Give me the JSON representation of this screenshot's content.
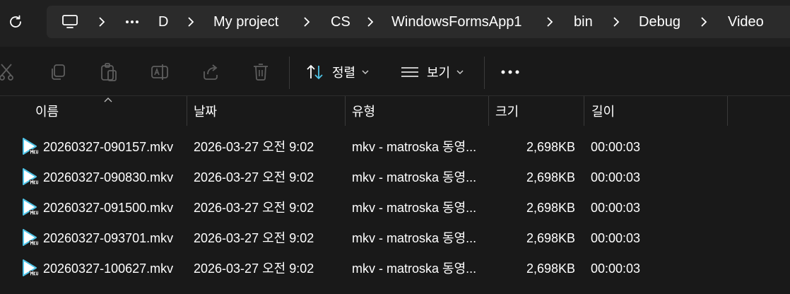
{
  "address": {
    "crumbs": [
      "D",
      "My project",
      "CS",
      "WindowsFormsApp1",
      "bin",
      "Debug",
      "Video"
    ]
  },
  "toolbar": {
    "sort_label": "정렬",
    "view_label": "보기"
  },
  "columns": [
    "이름",
    "날짜",
    "유형",
    "크기",
    "길이"
  ],
  "files": [
    {
      "name": "20260327-090157.mkv",
      "date": "2026-03-27 오전 9:02",
      "type": "mkv - matroska 동영...",
      "size": "2,698KB",
      "length": "00:00:03"
    },
    {
      "name": "20260327-090830.mkv",
      "date": "2026-03-27 오전 9:02",
      "type": "mkv - matroska 동영...",
      "size": "2,698KB",
      "length": "00:00:03"
    },
    {
      "name": "20260327-091500.mkv",
      "date": "2026-03-27 오전 9:02",
      "type": "mkv - matroska 동영...",
      "size": "2,698KB",
      "length": "00:00:03"
    },
    {
      "name": "20260327-093701.mkv",
      "date": "2026-03-27 오전 9:02",
      "type": "mkv - matroska 동영...",
      "size": "2,698KB",
      "length": "00:00:03"
    },
    {
      "name": "20260327-100627.mkv",
      "date": "2026-03-27 오전 9:02",
      "type": "mkv - matroska 동영...",
      "size": "2,698KB",
      "length": "00:00:03"
    }
  ],
  "colors": {
    "background": "#191919",
    "address_box": "#2b2b2b",
    "icon_cyan": "#4fc3e6",
    "disabled_icon": "#5e5e5e"
  }
}
